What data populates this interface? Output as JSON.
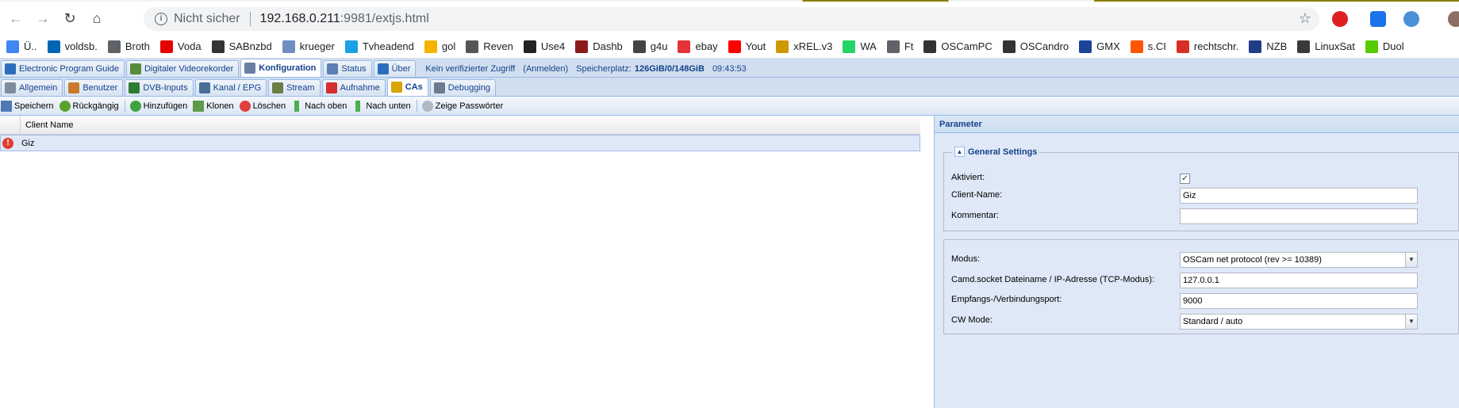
{
  "browser": {
    "security_label": "Nicht sicher",
    "url_host": "192.168.0.211",
    "url_path": ":9981/extjs.html"
  },
  "bookmarks": [
    {
      "label": "Ü..",
      "color": "#4285f4"
    },
    {
      "label": "voldsb.",
      "color": "#0066b3"
    },
    {
      "label": "Broth",
      "color": "#5f6368"
    },
    {
      "label": "Voda",
      "color": "#e60000"
    },
    {
      "label": "SABnzbd",
      "color": "#333333"
    },
    {
      "label": "krueger",
      "color": "#6f8fc2"
    },
    {
      "label": "Tvheadend",
      "color": "#1ba1e2"
    },
    {
      "label": "gol",
      "color": "#f4b400"
    },
    {
      "label": "Reven",
      "color": "#555555"
    },
    {
      "label": "Use4",
      "color": "#222222"
    },
    {
      "label": "Dashb",
      "color": "#8b1a1a"
    },
    {
      "label": "g4u",
      "color": "#444444"
    },
    {
      "label": "ebay",
      "color": "#e53238"
    },
    {
      "label": "Yout",
      "color": "#ff0000"
    },
    {
      "label": "xREL.v3",
      "color": "#cc9900"
    },
    {
      "label": "WA",
      "color": "#25d366"
    },
    {
      "label": "Ft",
      "color": "#5f6368"
    },
    {
      "label": "OSCamPC",
      "color": "#333333"
    },
    {
      "label": "OSCandro",
      "color": "#333333"
    },
    {
      "label": "GMX",
      "color": "#1c449b"
    },
    {
      "label": "s.CI",
      "color": "#ff5500"
    },
    {
      "label": "rechtschr.",
      "color": "#d93025"
    },
    {
      "label": "NZB",
      "color": "#1f3c88"
    },
    {
      "label": "LinuxSat",
      "color": "#3a3a3a"
    },
    {
      "label": "Duol",
      "color": "#58cc02"
    }
  ],
  "main_tabs": [
    {
      "label": "Electronic Program Guide",
      "icon": "epg-icon",
      "color": "#2c6ebd"
    },
    {
      "label": "Digitaler Videorekorder",
      "icon": "dvr-icon",
      "color": "#5a8a3c"
    },
    {
      "label": "Konfiguration",
      "icon": "wrench-icon",
      "color": "#6c7ea6",
      "active": true
    },
    {
      "label": "Status",
      "icon": "eye-icon",
      "color": "#5b7fb5"
    },
    {
      "label": "Über",
      "icon": "info-icon",
      "color": "#2c6ebd"
    }
  ],
  "status_bar": {
    "access": "Kein verifizierter Zugriff",
    "login": "(Anmelden)",
    "storage_label": "Speicherplatz:",
    "storage_value": "126GiB/0/148GiB",
    "time": "09:43:53"
  },
  "sub_tabs": [
    {
      "label": "Allgemein",
      "icon": "tools-icon",
      "color": "#7f8c9e"
    },
    {
      "label": "Benutzer",
      "icon": "users-icon",
      "color": "#c77b2a"
    },
    {
      "label": "DVB-Inputs",
      "icon": "card-icon",
      "color": "#2f7d32"
    },
    {
      "label": "Kanal / EPG",
      "icon": "tv-icon",
      "color": "#4b6e99"
    },
    {
      "label": "Stream",
      "icon": "stream-icon",
      "color": "#6b7f45"
    },
    {
      "label": "Aufnahme",
      "icon": "rec-icon",
      "color": "#d32f2f"
    },
    {
      "label": "CAs",
      "icon": "key-icon",
      "color": "#d9a400",
      "active": true
    },
    {
      "label": "Debugging",
      "icon": "debug-icon",
      "color": "#6a7b92"
    }
  ],
  "toolbar": {
    "save": "Speichern",
    "undo": "Rückgängig",
    "add": "Hinzufügen",
    "clone": "Klonen",
    "delete": "Löschen",
    "up": "Nach oben",
    "down": "Nach unten",
    "passwords": "Zeige Passwörter"
  },
  "grid": {
    "column_header": "Client Name",
    "rows": [
      {
        "name": "Giz"
      }
    ]
  },
  "panel": {
    "title": "Parameter",
    "general_legend": "General Settings",
    "enabled_label": "Aktiviert:",
    "enabled": true,
    "client_name_label": "Client-Name:",
    "client_name_value": "Giz",
    "comment_label": "Kommentar:",
    "comment_value": "",
    "mode_label": "Modus:",
    "mode_value": "OSCam net protocol (rev >= 10389)",
    "socket_label": "Camd.socket Dateiname / IP-Adresse (TCP-Modus):",
    "socket_value": "127.0.0.1",
    "port_label": "Empfangs-/Verbindungsport:",
    "port_value": "9000",
    "cw_label": "CW Mode:",
    "cw_value": "Standard / auto"
  }
}
